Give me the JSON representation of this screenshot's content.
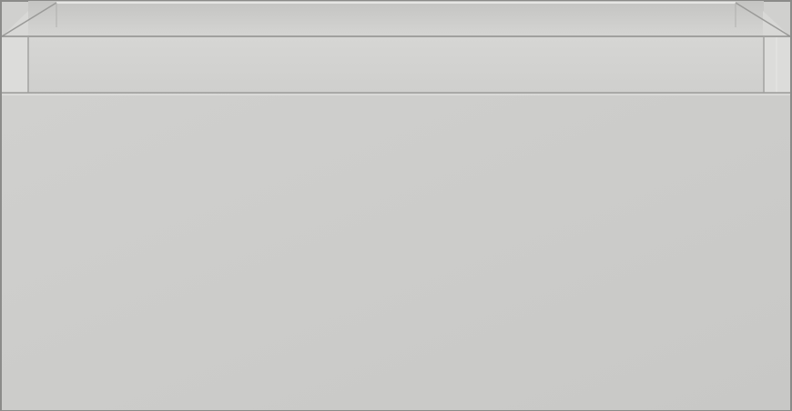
{
  "product": {
    "type": "wall-mounted drawer unit",
    "view": "front",
    "colors": {
      "body": "#cfcfcd",
      "front_panel": "#cccccb",
      "inner_back": "#c8c8c6",
      "side_highlight": "#e2e2e0",
      "edge_line": "#8f8f8d",
      "shadow": "#b8b8b6",
      "outline": "#8b8b89"
    }
  }
}
